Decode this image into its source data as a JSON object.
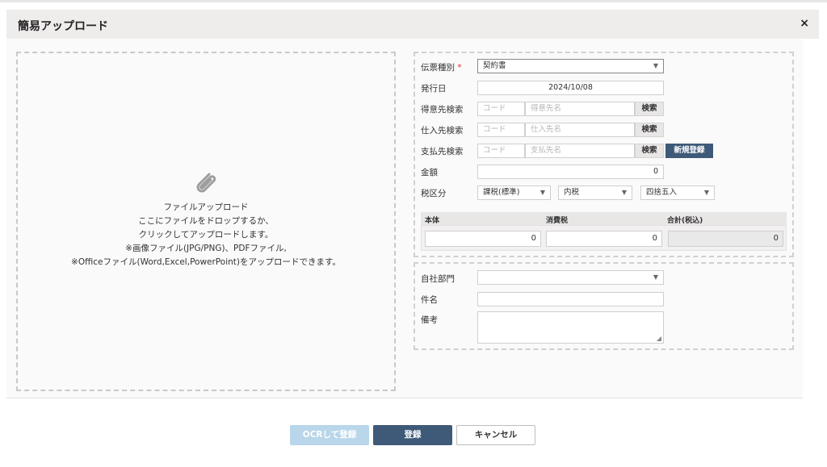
{
  "dialog": {
    "title": "簡易アップロード",
    "close_label": "×"
  },
  "dropzone": {
    "lines": [
      "ファイルアップロード",
      "ここにファイルをドロップするか、",
      "クリックしてアップロードします。",
      "※画像ファイル(JPG/PNG)、PDFファイル,",
      "※Officeファイル(Word,Excel,PowerPoint)をアップロードできます。"
    ]
  },
  "form": {
    "voucher_type": {
      "label": "伝票種別",
      "required_mark": "*",
      "value": "契約書"
    },
    "issue_date": {
      "label": "発行日",
      "value": "2024/10/08"
    },
    "customer_search": {
      "label": "得意先検索",
      "code_placeholder": "コード",
      "name_placeholder": "得意先名",
      "search_label": "検索"
    },
    "supplier_search": {
      "label": "仕入先検索",
      "code_placeholder": "コード",
      "name_placeholder": "仕入先名",
      "search_label": "検索"
    },
    "payee_search": {
      "label": "支払先検索",
      "code_placeholder": "コード",
      "name_placeholder": "支払先名",
      "search_label": "検索",
      "new_label": "新規登録"
    },
    "amount": {
      "label": "金額",
      "value": "0"
    },
    "tax": {
      "label": "税区分",
      "type": "課税(標準)",
      "method": "内税",
      "rounding": "四捨五入"
    },
    "breakdown": {
      "headers": [
        "本体",
        "消費税",
        "合計(税込)"
      ],
      "values": [
        "0",
        "0",
        "0"
      ]
    },
    "department": {
      "label": "自社部門",
      "value": ""
    },
    "subject": {
      "label": "件名",
      "value": ""
    },
    "remarks": {
      "label": "備考",
      "value": ""
    }
  },
  "footer": {
    "ocr_label": "OCRして登録",
    "register_label": "登録",
    "cancel_label": "キャンセル"
  },
  "colors": {
    "primary": "#3e5a78",
    "ocr_disabled": "#b9d6ea",
    "required": "#d9333f"
  }
}
